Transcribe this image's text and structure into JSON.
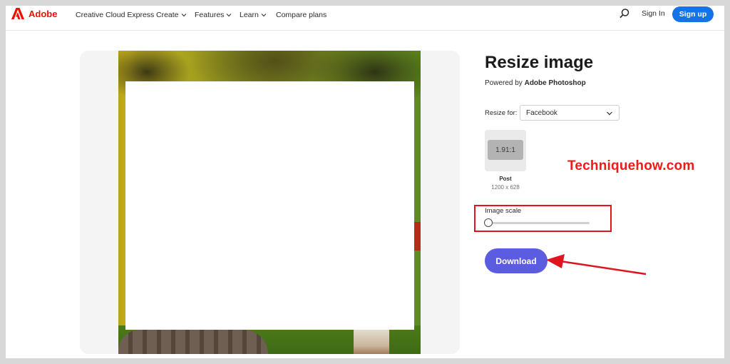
{
  "header": {
    "brand": "Adobe",
    "nav": [
      {
        "label": "Creative Cloud Express",
        "has_dropdown": false
      },
      {
        "label": "Create",
        "has_dropdown": true
      },
      {
        "label": "Features",
        "has_dropdown": true
      },
      {
        "label": "Learn",
        "has_dropdown": true
      },
      {
        "label": "Compare plans",
        "has_dropdown": false
      }
    ],
    "search_icon": "search-icon",
    "sign_in": "Sign In",
    "sign_up": "Sign up"
  },
  "tool": {
    "title": "Resize image",
    "powered_prefix": "Powered by ",
    "powered_brand": "Adobe Photoshop",
    "resize_for_label": "Resize for:",
    "resize_for_value": "Facebook",
    "preset": {
      "ratio": "1.91:1",
      "name": "Post",
      "size": "1200 x 628"
    },
    "image_scale_label": "Image scale",
    "image_scale_value": 0,
    "download": "Download"
  },
  "annotation": {
    "watermark": "Techniquehow.com"
  },
  "colors": {
    "adobe_red": "#eb1000",
    "signup_blue": "#1473e6",
    "download_purple": "#5c5ce0",
    "annotation_red": "#e0141e"
  }
}
